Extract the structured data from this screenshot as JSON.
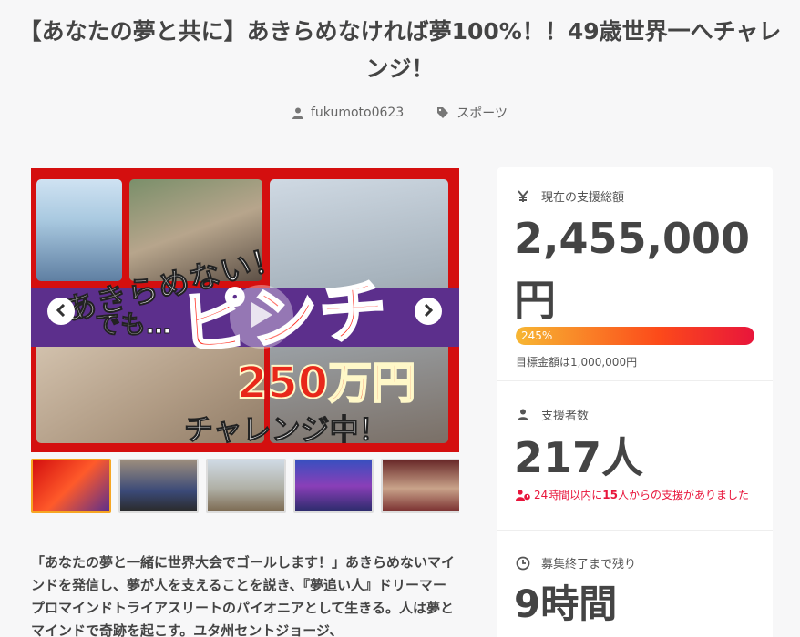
{
  "project": {
    "title": "【あなたの夢と共に】あきらめなければ夢100%！！49歳世界一へチャレンジ！",
    "author": "fukumoto0623",
    "category": "スポーツ"
  },
  "media": {
    "overlay_text": {
      "line1": "あきらめない！",
      "line2": "でも…",
      "line3": "ピンチ",
      "line4": "250万円",
      "line5": "チャレンジ中！"
    },
    "thumbnails": [
      {
        "label": "thumbnail-1",
        "active": true
      },
      {
        "label": "thumbnail-2",
        "active": false
      },
      {
        "label": "thumbnail-3",
        "active": false
      },
      {
        "label": "thumbnail-4",
        "active": false
      },
      {
        "label": "thumbnail-5",
        "active": false
      }
    ]
  },
  "description": "「あなたの夢と一緒に世界大会でゴールします！」あきらめないマインドを発信し、夢が人を支えることを説き、『夢追い人』ドリーマープロマインドトライアスリートのパイオニアとして生きる。人は夢とマインドで奇跡を起こす。ユタ州セントジョージ、",
  "stats": {
    "total_label": "現在の支援総額",
    "total_value": "2,455,000円",
    "progress_label": "245%",
    "progress_fraction": 1.0,
    "goal_text": "目標金額は1,000,000円",
    "supporters_label": "支援者数",
    "supporters_value": "217人",
    "recent_prefix": "24時間以内に",
    "recent_count": "15",
    "recent_suffix": "人からの支援がありました",
    "remaining_label": "募集終了まで残り",
    "remaining_value": "9時間"
  },
  "colors": {
    "accent": "#e8153b",
    "progress_start": "#f7b733",
    "active_thumb_border": "#f6a623"
  },
  "icons": {
    "author": "user-icon",
    "category": "tag-icon",
    "total": "yen-icon",
    "supporters": "user-icon",
    "recent": "user-clock-icon",
    "remaining": "clock-icon",
    "prev": "chevron-left-icon",
    "next": "chevron-right-icon",
    "play": "play-icon"
  }
}
